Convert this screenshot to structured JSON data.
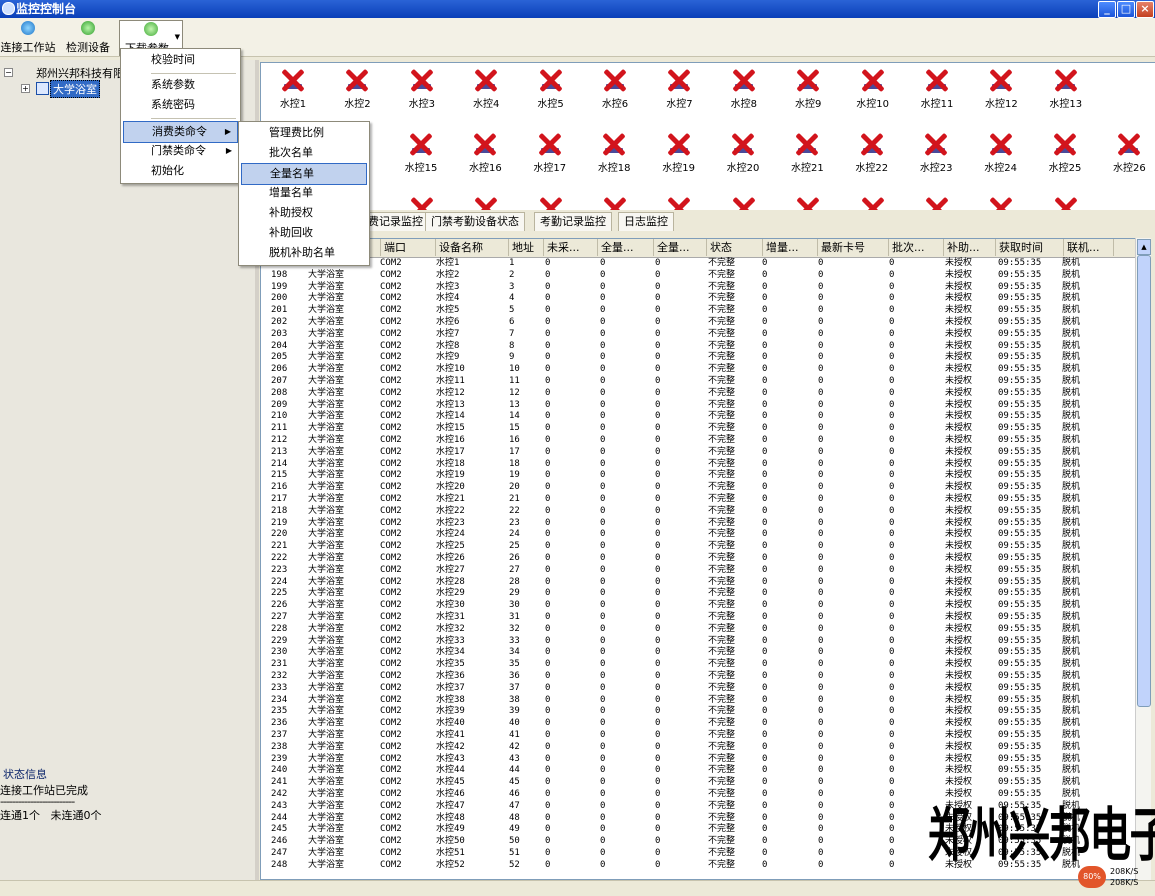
{
  "window": {
    "title": "监控控制台",
    "min": "_",
    "max": "□",
    "close": "×"
  },
  "toolbar": {
    "connect_label": "连接工作站",
    "detect_label": "检测设备",
    "download_label": "下载参数"
  },
  "menu_main": [
    "校验时间",
    "系统参数",
    "系统密码",
    "消费类命令",
    "门禁类命令",
    "初始化"
  ],
  "menu_sub": [
    "管理费比例",
    "批次名单",
    "全量名单",
    "增量名单",
    "补助授权",
    "补助回收",
    "脱机补助名单"
  ],
  "tree": {
    "root": "郑州兴邦科技有限",
    "child": "大学浴室"
  },
  "status_info": {
    "header": "状态信息",
    "line1": "连接工作站已完成",
    "separator": "-------------------------",
    "line2": "连通1个   未连通0个"
  },
  "devices": {
    "row1": [
      "水控1",
      "水控2",
      "水控3",
      "水控4",
      "水控5",
      "水控6",
      "水控7",
      "水控8",
      "水控9",
      "水控10",
      "水控11",
      "水控12",
      "水控13"
    ],
    "row2": [
      "水控15",
      "水控16",
      "水控17",
      "水控18",
      "水控19",
      "水控20",
      "水控21",
      "水控22",
      "水控23",
      "水控24",
      "水控25",
      "水控26"
    ]
  },
  "tabs": [
    "费记录监控",
    "门禁考勤设备状态",
    "考勤记录监控",
    "日志监控"
  ],
  "table": {
    "headers": [
      "",
      "",
      "端口",
      "设备名称",
      "地址",
      "未采...",
      "全量...",
      "全量...",
      "状态",
      "增量...",
      "最新卡号",
      "批次...",
      "补助...",
      "获取时间",
      "联机..."
    ],
    "area": "大学浴室",
    "port": "COM2",
    "device_prefix": "水控",
    "zero": "0",
    "status": "不完整",
    "auth": "未授权",
    "time": "09:55:35",
    "mode": "脱机",
    "first_seq": 197,
    "first_addr": 1,
    "count": 52
  },
  "watermark": "郑州兴邦电子",
  "net": {
    "pct": "80%",
    "up": "208K/S",
    "down": "208K/S"
  }
}
